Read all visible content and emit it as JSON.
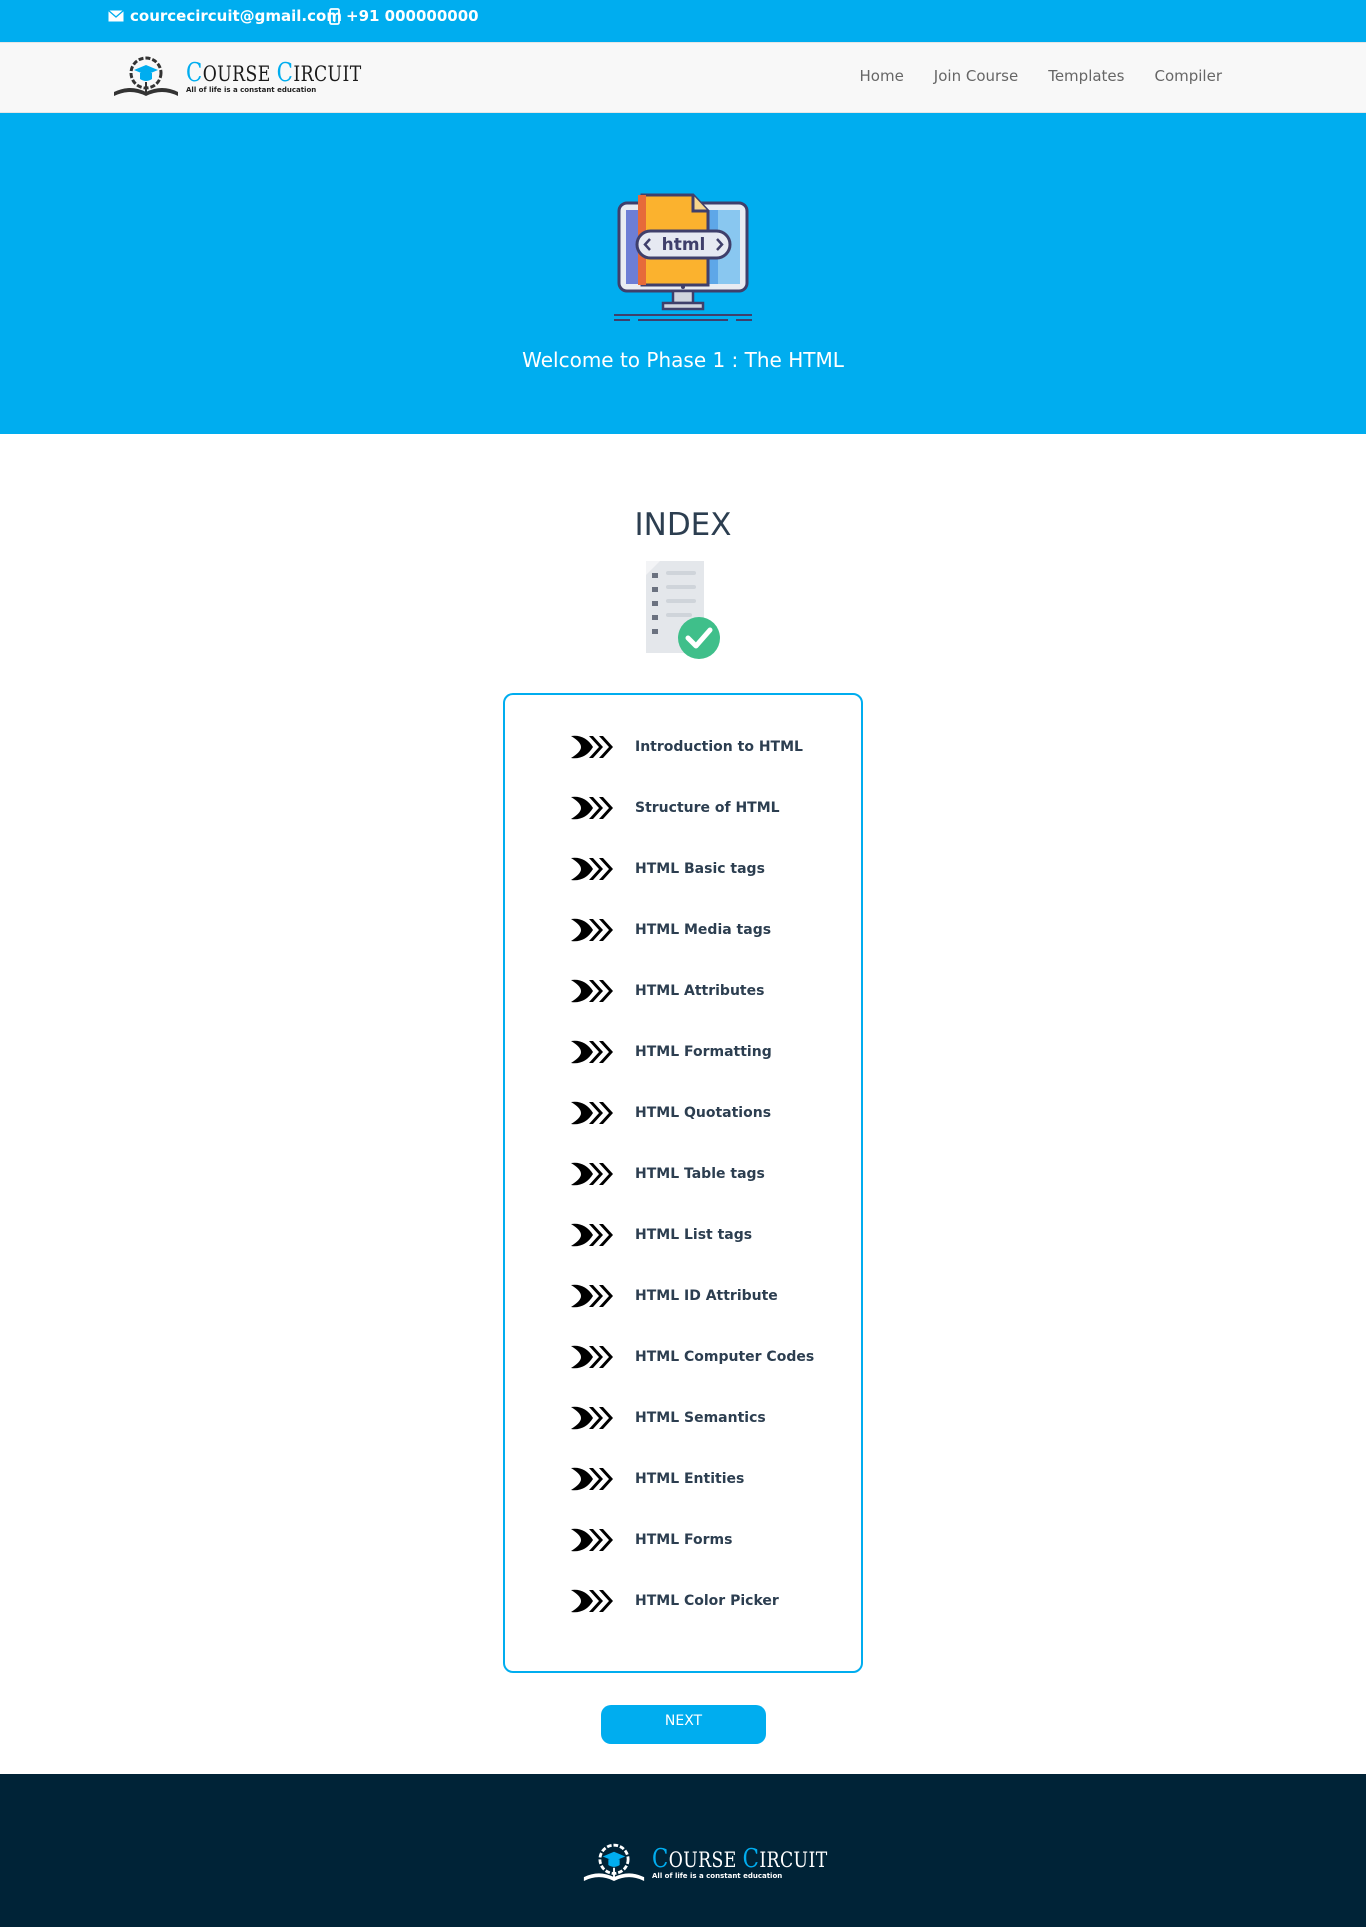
{
  "topbar": {
    "email": "courcecircuit@gmail.com",
    "phone": "+91 000000000"
  },
  "brand": {
    "name_first_cap": "C",
    "name_first_rest": "OURSE",
    "name_second_cap": "C",
    "name_second_rest": "IRCUIT",
    "tagline": "All of life is a constant education"
  },
  "nav": {
    "items": [
      {
        "label": "Home"
      },
      {
        "label": "Join Course"
      },
      {
        "label": "Templates"
      },
      {
        "label": "Compiler"
      }
    ]
  },
  "hero": {
    "badge": "html",
    "title": "Welcome to Phase 1 : The HTML"
  },
  "index": {
    "title": "INDEX",
    "items": [
      {
        "label": "Introduction to HTML"
      },
      {
        "label": "Structure of HTML"
      },
      {
        "label": "HTML Basic tags"
      },
      {
        "label": "HTML Media tags"
      },
      {
        "label": "HTML Attributes"
      },
      {
        "label": "HTML Formatting"
      },
      {
        "label": "HTML Quotations"
      },
      {
        "label": "HTML Table tags"
      },
      {
        "label": "HTML List tags"
      },
      {
        "label": "HTML ID Attribute"
      },
      {
        "label": "HTML Computer Codes"
      },
      {
        "label": "HTML Semantics"
      },
      {
        "label": "HTML Entities"
      },
      {
        "label": "HTML Forms"
      },
      {
        "label": "HTML Color Picker"
      }
    ]
  },
  "next_button": {
    "label": "NEXT"
  },
  "colors": {
    "accent": "#00adef",
    "footer": "#002337",
    "text": "#2c3e50"
  },
  "icons": [
    "mail-icon",
    "phone-icon",
    "double-arrow-icon",
    "monitor-html-icon",
    "document-check-icon",
    "logo-icon"
  ]
}
